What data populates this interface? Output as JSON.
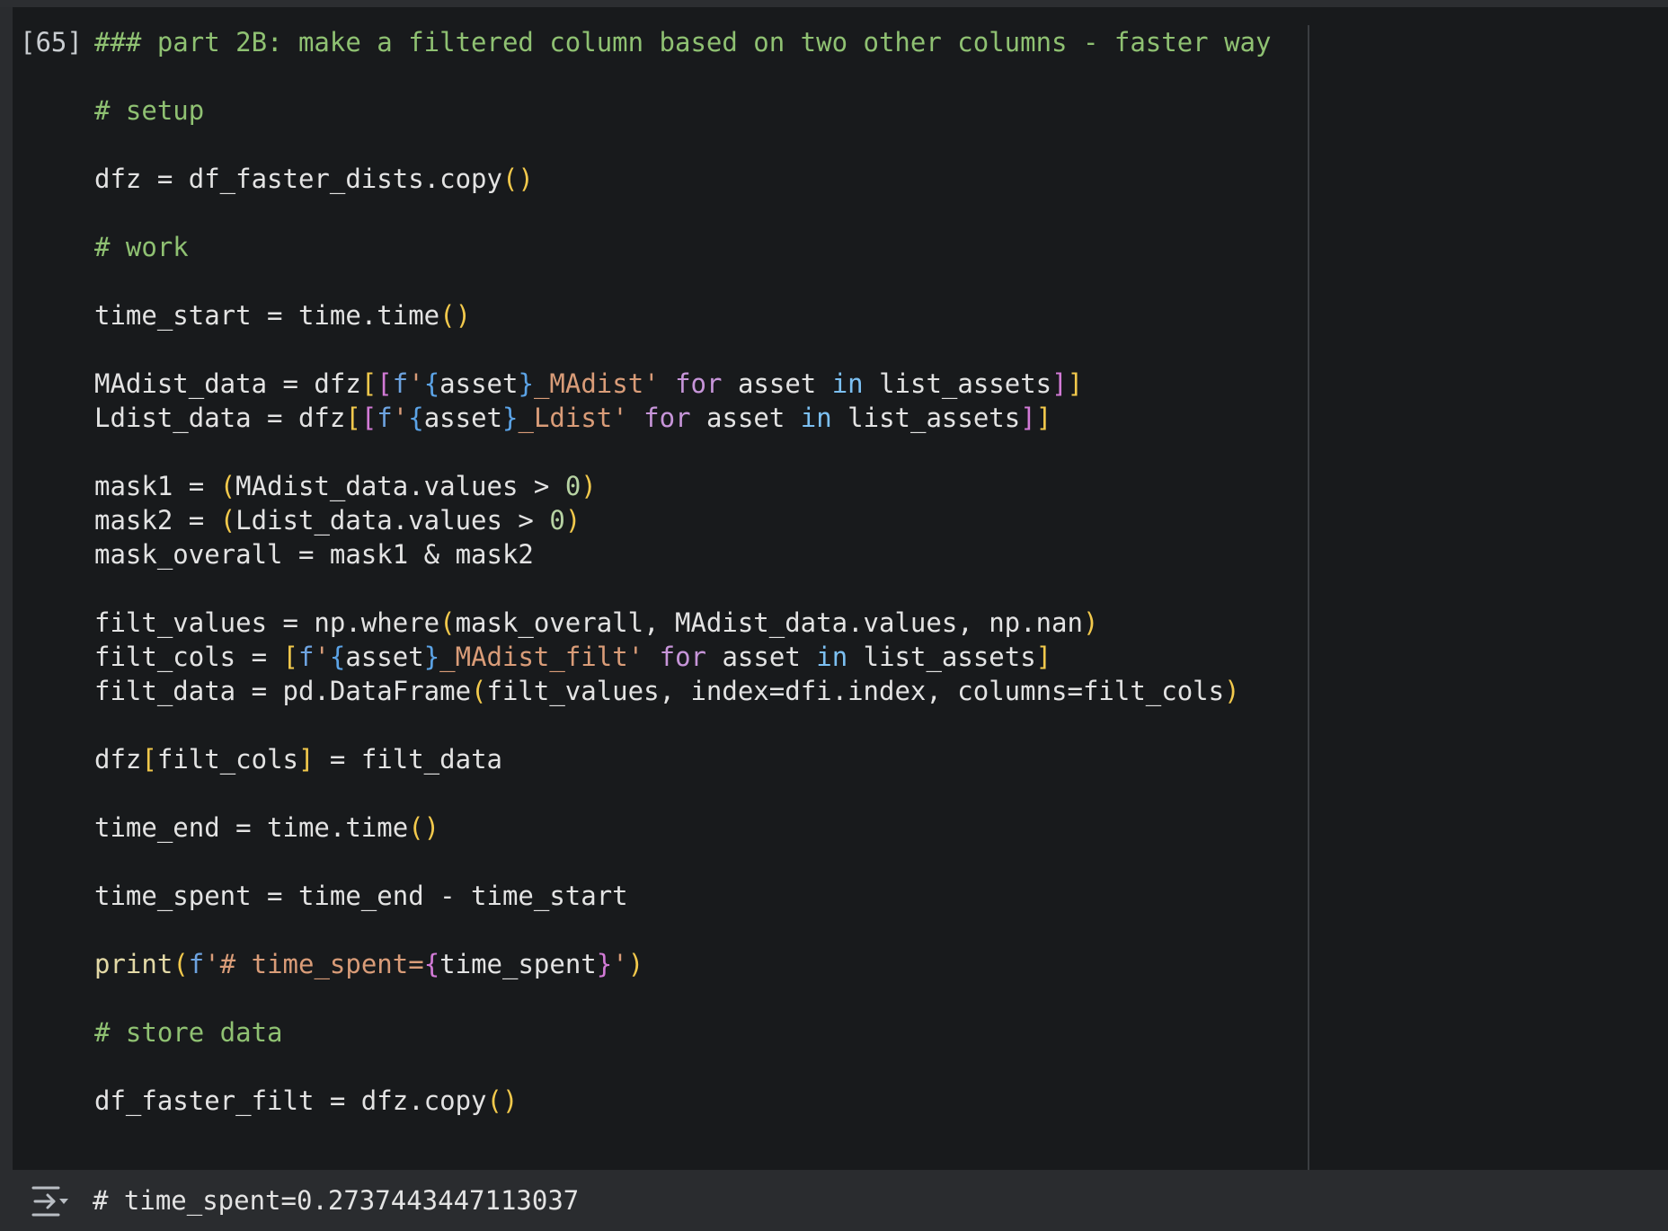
{
  "cell": {
    "execution_count": "[65]",
    "lines": [
      [
        {
          "t": "### part 2B: make a filtered column based on two other columns - faster way",
          "c": "com"
        }
      ],
      [],
      [
        {
          "t": "# setup",
          "c": "com"
        }
      ],
      [],
      [
        {
          "t": "dfz = df_faster_dists.copy"
        },
        {
          "t": "()",
          "c": "p1"
        }
      ],
      [],
      [
        {
          "t": "# work",
          "c": "com"
        }
      ],
      [],
      [
        {
          "t": "time_start = time.time"
        },
        {
          "t": "()",
          "c": "p1"
        }
      ],
      [],
      [
        {
          "t": "MAdist_data = dfz"
        },
        {
          "t": "[",
          "c": "p1"
        },
        {
          "t": "[",
          "c": "p2"
        },
        {
          "t": "f",
          "c": "fpre"
        },
        {
          "t": "'",
          "c": "str"
        },
        {
          "t": "{",
          "c": "p3"
        },
        {
          "t": "asset"
        },
        {
          "t": "}",
          "c": "p3"
        },
        {
          "t": "_MAdist'",
          "c": "str"
        },
        {
          "t": " "
        },
        {
          "t": "for",
          "c": "kw"
        },
        {
          "t": " asset "
        },
        {
          "t": "in",
          "c": "kw2"
        },
        {
          "t": " list_assets"
        },
        {
          "t": "]",
          "c": "p2"
        },
        {
          "t": "]",
          "c": "p1"
        }
      ],
      [
        {
          "t": "Ldist_data = dfz"
        },
        {
          "t": "[",
          "c": "p1"
        },
        {
          "t": "[",
          "c": "p2"
        },
        {
          "t": "f",
          "c": "fpre"
        },
        {
          "t": "'",
          "c": "str"
        },
        {
          "t": "{",
          "c": "p3"
        },
        {
          "t": "asset"
        },
        {
          "t": "}",
          "c": "p3"
        },
        {
          "t": "_Ldist'",
          "c": "str"
        },
        {
          "t": " "
        },
        {
          "t": "for",
          "c": "kw"
        },
        {
          "t": " asset "
        },
        {
          "t": "in",
          "c": "kw2"
        },
        {
          "t": " list_assets"
        },
        {
          "t": "]",
          "c": "p2"
        },
        {
          "t": "]",
          "c": "p1"
        }
      ],
      [],
      [
        {
          "t": "mask1 = "
        },
        {
          "t": "(",
          "c": "p1"
        },
        {
          "t": "MAdist_data.values > "
        },
        {
          "t": "0",
          "c": "num"
        },
        {
          "t": ")",
          "c": "p1"
        }
      ],
      [
        {
          "t": "mask2 = "
        },
        {
          "t": "(",
          "c": "p1"
        },
        {
          "t": "Ldist_data.values > "
        },
        {
          "t": "0",
          "c": "num"
        },
        {
          "t": ")",
          "c": "p1"
        }
      ],
      [
        {
          "t": "mask_overall = mask1 & mask2"
        }
      ],
      [],
      [
        {
          "t": "filt_values = np.where"
        },
        {
          "t": "(",
          "c": "p1"
        },
        {
          "t": "mask_overall, MAdist_data.values, np.nan"
        },
        {
          "t": ")",
          "c": "p1"
        }
      ],
      [
        {
          "t": "filt_cols = "
        },
        {
          "t": "[",
          "c": "p1"
        },
        {
          "t": "f",
          "c": "fpre"
        },
        {
          "t": "'",
          "c": "str"
        },
        {
          "t": "{",
          "c": "p3"
        },
        {
          "t": "asset"
        },
        {
          "t": "}",
          "c": "p3"
        },
        {
          "t": "_MAdist_filt'",
          "c": "str"
        },
        {
          "t": " "
        },
        {
          "t": "for",
          "c": "kw"
        },
        {
          "t": " asset "
        },
        {
          "t": "in",
          "c": "kw2"
        },
        {
          "t": " list_assets"
        },
        {
          "t": "]",
          "c": "p1"
        }
      ],
      [
        {
          "t": "filt_data = pd.DataFrame"
        },
        {
          "t": "(",
          "c": "p1"
        },
        {
          "t": "filt_values, index=dfi.index, columns=filt_cols"
        },
        {
          "t": ")",
          "c": "p1"
        }
      ],
      [],
      [
        {
          "t": "dfz"
        },
        {
          "t": "[",
          "c": "p1"
        },
        {
          "t": "filt_cols"
        },
        {
          "t": "]",
          "c": "p1"
        },
        {
          "t": " = filt_data"
        }
      ],
      [],
      [
        {
          "t": "time_end = time.time"
        },
        {
          "t": "()",
          "c": "p1"
        }
      ],
      [],
      [
        {
          "t": "time_spent = time_end - time_start"
        }
      ],
      [],
      [
        {
          "t": "print",
          "c": "fn"
        },
        {
          "t": "(",
          "c": "p1"
        },
        {
          "t": "f",
          "c": "fpre"
        },
        {
          "t": "'# time_spent=",
          "c": "str"
        },
        {
          "t": "{",
          "c": "p2"
        },
        {
          "t": "time_spent"
        },
        {
          "t": "}",
          "c": "p2"
        },
        {
          "t": "'",
          "c": "str"
        },
        {
          "t": ")",
          "c": "p1"
        }
      ],
      [],
      [
        {
          "t": "# store data",
          "c": "com"
        }
      ],
      [],
      [
        {
          "t": "df_faster_filt = dfz.copy"
        },
        {
          "t": "()",
          "c": "p1"
        }
      ]
    ]
  },
  "output": {
    "icon": "output-collapse-icon",
    "text": "# time_spent=0.2737443447113037"
  }
}
